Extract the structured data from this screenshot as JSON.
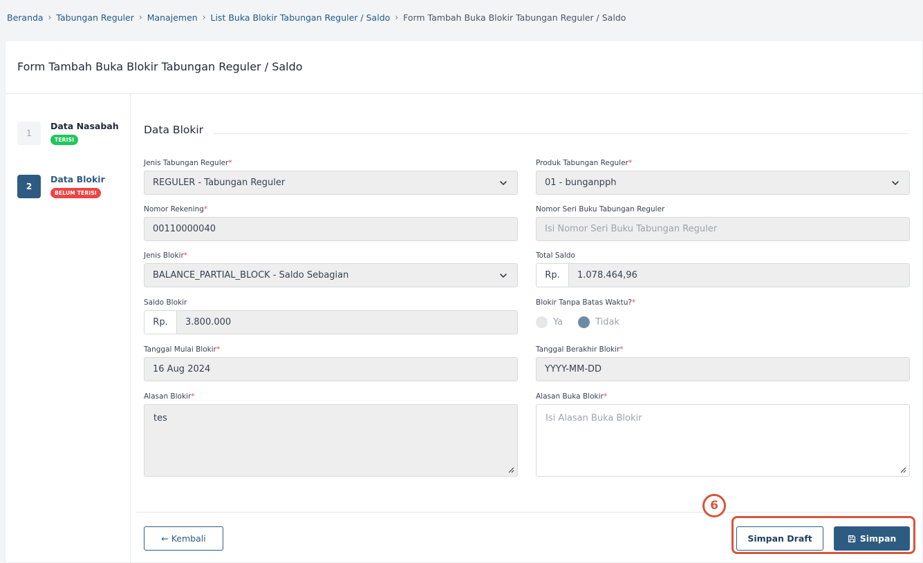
{
  "breadcrumb": {
    "items": [
      "Beranda",
      "Tabungan Reguler",
      "Manajemen",
      "List Buka Blokir Tabungan Reguler / Saldo"
    ],
    "current": "Form Tambah Buka Blokir Tabungan Reguler / Saldo",
    "separator": "›"
  },
  "page_title": "Form Tambah Buka Blokir Tabungan Reguler / Saldo",
  "steps": [
    {
      "number": "1",
      "label": "Data Nasabah",
      "badge": "TERISI"
    },
    {
      "number": "2",
      "label": "Data Blokir",
      "badge": "BELUM TERISI"
    }
  ],
  "section_title": "Data Blokir",
  "form": {
    "jenis_tabungan": {
      "label": "Jenis Tabungan Reguler",
      "required": "*",
      "value": "REGULER - Tabungan Reguler"
    },
    "produk_tabungan": {
      "label": "Produk Tabungan Reguler",
      "required": "*",
      "value": "01 - bunganpph"
    },
    "nomor_rekening": {
      "label": "Nomor Rekening",
      "required": "*",
      "value": "00110000040"
    },
    "nomor_seri": {
      "label": "Nomor Seri Buku Tabungan Reguler",
      "placeholder": "Isi Nomor Seri Buku Tabungan Reguler"
    },
    "jenis_blokir": {
      "label": "Jenis Blokir",
      "required": "*",
      "value": "BALANCE_PARTIAL_BLOCK - Saldo Sebagian"
    },
    "total_saldo": {
      "label": "Total Saldo",
      "prefix": "Rp.",
      "value": "1.078.464,96"
    },
    "saldo_blokir": {
      "label": "Saldo Blokir",
      "prefix": "Rp.",
      "value": "3.800.000"
    },
    "blokir_tanpa_batas": {
      "label": "Blokir Tanpa Batas Waktu?",
      "required": "*",
      "options": [
        "Ya",
        "Tidak"
      ],
      "selected": "Tidak"
    },
    "tanggal_mulai": {
      "label": "Tanggal Mulai Blokir",
      "required": "*",
      "value": "16 Aug 2024"
    },
    "tanggal_berakhir": {
      "label": "Tanggal Berakhir Blokir",
      "required": "*",
      "value": "YYYY-MM-DD"
    },
    "alasan_blokir": {
      "label": "Alasan Blokir",
      "required": "*",
      "value": "tes"
    },
    "alasan_buka_blokir": {
      "label": "Alasan Buka Blokir",
      "required": "*",
      "placeholder": "Isi Alasan Buka Blokir"
    }
  },
  "buttons": {
    "back": "← Kembali",
    "draft": "Simpan Draft",
    "save": "Simpan"
  },
  "annotation": {
    "number": "6",
    "color": "#d9543a"
  },
  "colors": {
    "primary": "#2d5b82",
    "success": "#22c55e",
    "danger": "#ef4444"
  }
}
